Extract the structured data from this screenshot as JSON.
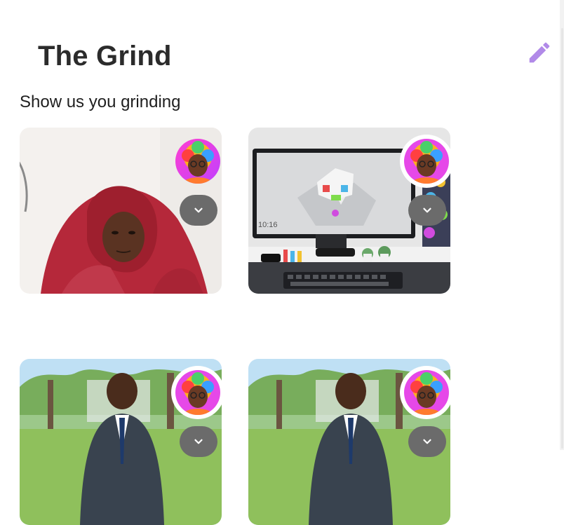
{
  "page": {
    "title": "The Grind",
    "subtitle": "Show us you grinding"
  },
  "toolbar": {
    "edit_icon": "pencil-icon",
    "accent": "#b18ae8"
  },
  "cards": [
    {
      "photo": "person in red hoodie",
      "avatar_icon": "rainbow-avatar",
      "menu_icon": "chevron-down-icon"
    },
    {
      "photo": "desk setup with monitor",
      "avatar_icon": "rainbow-avatar",
      "menu_icon": "chevron-down-icon",
      "screen_time": "10:16"
    },
    {
      "photo": "man in suit outdoors",
      "avatar_icon": "rainbow-avatar",
      "menu_icon": "chevron-down-icon"
    },
    {
      "photo": "man in suit outdoors",
      "avatar_icon": "rainbow-avatar",
      "menu_icon": "chevron-down-icon"
    }
  ]
}
